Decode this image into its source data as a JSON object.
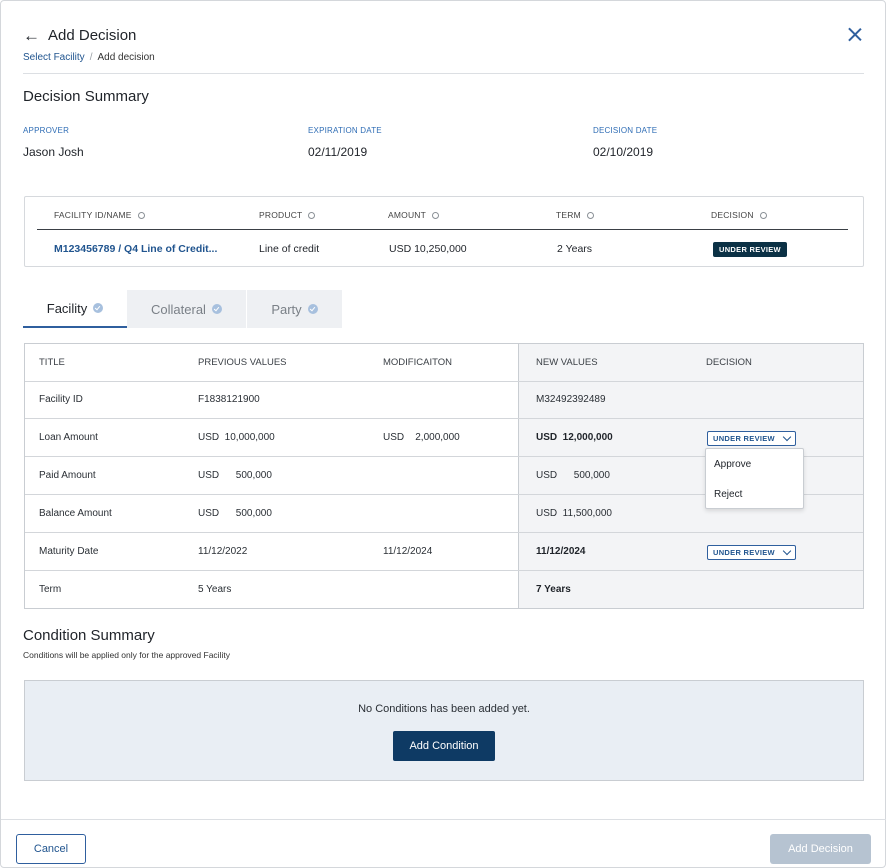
{
  "header": {
    "title": "Add Decision",
    "breadcrumb": [
      "Select Facility",
      "Add decision"
    ],
    "breadcrumb_sep": "/"
  },
  "summary": {
    "title": "Decision Summary",
    "fields": [
      {
        "label": "APPROVER",
        "value": "Jason Josh"
      },
      {
        "label": "EXPIRATION DATE",
        "value": "02/11/2019"
      },
      {
        "label": "DECISION DATE",
        "value": "02/10/2019"
      }
    ]
  },
  "facility_table": {
    "columns": [
      "FACILITY ID/NAME",
      "PRODUCT",
      "AMOUNT",
      "TERM",
      "DECISION"
    ],
    "row": {
      "facility": "M123456789 / Q4 Line of Credit...",
      "product": "Line of credit",
      "amount": "USD  10,250,000",
      "term": "2 Years",
      "decision": "UNDER REVIEW"
    }
  },
  "tabs": [
    {
      "label": "Facility",
      "active": true
    },
    {
      "label": "Collateral",
      "active": false
    },
    {
      "label": "Party",
      "active": false
    }
  ],
  "values_table": {
    "columns": [
      "TITLE",
      "PREVIOUS VALUES",
      "MODIFICAITON",
      "NEW VALUES",
      "DECISION"
    ],
    "rows": [
      {
        "title": "Facility ID",
        "previous": "F1838121900",
        "modification": "",
        "new": "M32492392489",
        "new_bold": false,
        "decision": ""
      },
      {
        "title": "Loan Amount",
        "previous": "USD  10,000,000",
        "modification": "USD    2,000,000",
        "new": "USD  12,000,000",
        "new_bold": true,
        "decision": "UNDER REVIEW"
      },
      {
        "title": "Paid Amount",
        "previous": "USD      500,000",
        "modification": "",
        "new": "USD      500,000",
        "new_bold": false,
        "decision": ""
      },
      {
        "title": "Balance Amount",
        "previous": "USD      500,000",
        "modification": "",
        "new": "USD  11,500,000",
        "new_bold": false,
        "decision": ""
      },
      {
        "title": "Maturity Date",
        "previous": "11/12/2022",
        "modification": "11/12/2024",
        "new": "11/12/2024",
        "new_bold": true,
        "decision": "UNDER REVIEW"
      },
      {
        "title": "Term",
        "previous": "5 Years",
        "modification": "",
        "new": "7 Years",
        "new_bold": true,
        "decision": ""
      }
    ],
    "dropdown_options": [
      "Approve",
      "Reject"
    ]
  },
  "conditions": {
    "title": "Condition Summary",
    "subtitle": "Conditions will be applied only for the approved Facility",
    "empty_message": "No Conditions has been added yet.",
    "add_label": "Add Condition"
  },
  "footer": {
    "cancel_label": "Cancel",
    "submit_label": "Add Decision"
  },
  "colors": {
    "primary": "#0e3a64",
    "link": "#21558f",
    "badge": "#0b3145",
    "disabled": "#b6c3d1",
    "conditions_bg": "#e9eef4"
  }
}
